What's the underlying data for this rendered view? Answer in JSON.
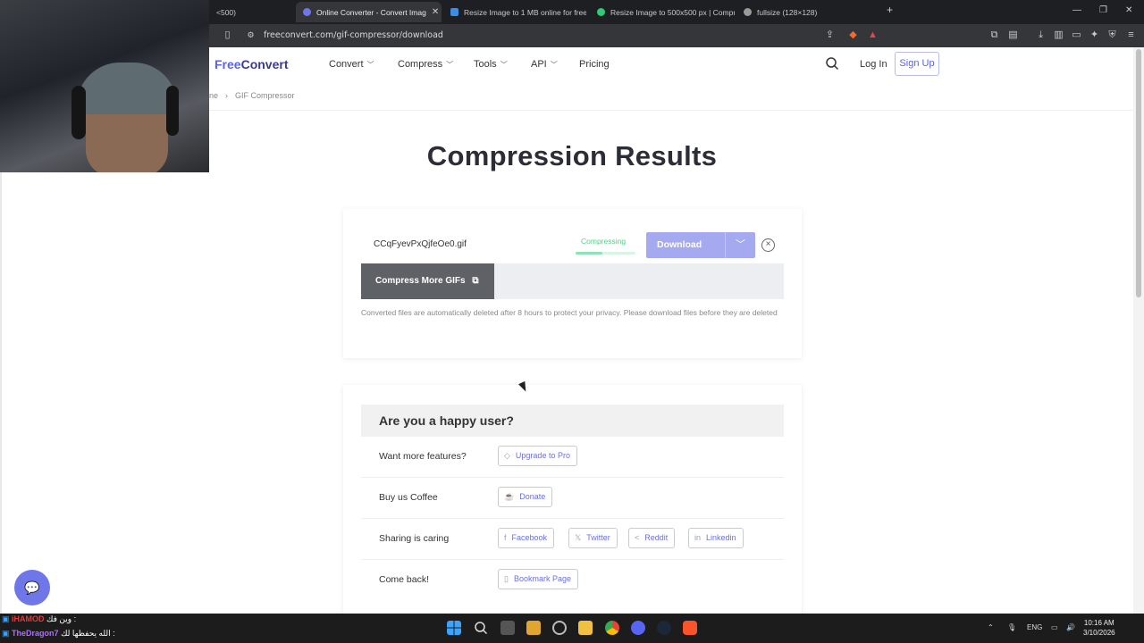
{
  "browser": {
    "tabs": [
      {
        "label": "<500)",
        "active": false
      },
      {
        "label": "Online Converter - Convert Imag",
        "active": true
      },
      {
        "label": "Resize Image to 1 MB online for free",
        "active": false
      },
      {
        "label": "Resize Image to 500x500 px | Compr",
        "active": false
      },
      {
        "label": "fullsize (128×128)",
        "active": false
      }
    ],
    "new_tab": "+",
    "url": "freeconvert.com/gif-compressor/download"
  },
  "nav": {
    "logo_free": "Free",
    "logo_convert": "Convert",
    "items": [
      "Convert",
      "Compress",
      "Tools",
      "API",
      "Pricing"
    ],
    "login": "Log In",
    "signup": "Sign Up"
  },
  "breadcrumb": {
    "home": "ne",
    "current": "GIF Compressor"
  },
  "page_title": "Compression Results",
  "result": {
    "filename": "CCqFyevPxQjfeOe0.gif",
    "status": "Compressing",
    "progress_fraction": 0.45,
    "download_label": "Download",
    "compress_more": "Compress More GIFs",
    "note": "Converted files are automatically deleted after 8 hours to protect your privacy. Please download files before they are deleted"
  },
  "happy": {
    "title": "Are you a happy user?",
    "rows": [
      {
        "label": "Want more features?",
        "buttons": [
          "Upgrade to Pro"
        ]
      },
      {
        "label": "Buy us Coffee",
        "buttons": [
          "Donate"
        ]
      },
      {
        "label": "Sharing is caring",
        "buttons": [
          "Facebook",
          "Twitter",
          "Reddit",
          "Linkedin"
        ]
      },
      {
        "label": "Come back!",
        "buttons": [
          "Bookmark Page"
        ]
      }
    ]
  },
  "stream_chat": [
    {
      "user": "iHAMOD",
      "message": "وين فك :",
      "color": "#e03b3b"
    },
    {
      "user": "TheDragon7",
      "message": "الله يحفظها لك :",
      "color": "#b36bff"
    }
  ],
  "taskbar": {
    "language": "ENG",
    "time": "10:16 AM",
    "date": "3/10/2026"
  },
  "colors": {
    "brand": "#5b63e6",
    "download_disabled": "#a4a9f0",
    "status_green": "#4cd38a"
  }
}
